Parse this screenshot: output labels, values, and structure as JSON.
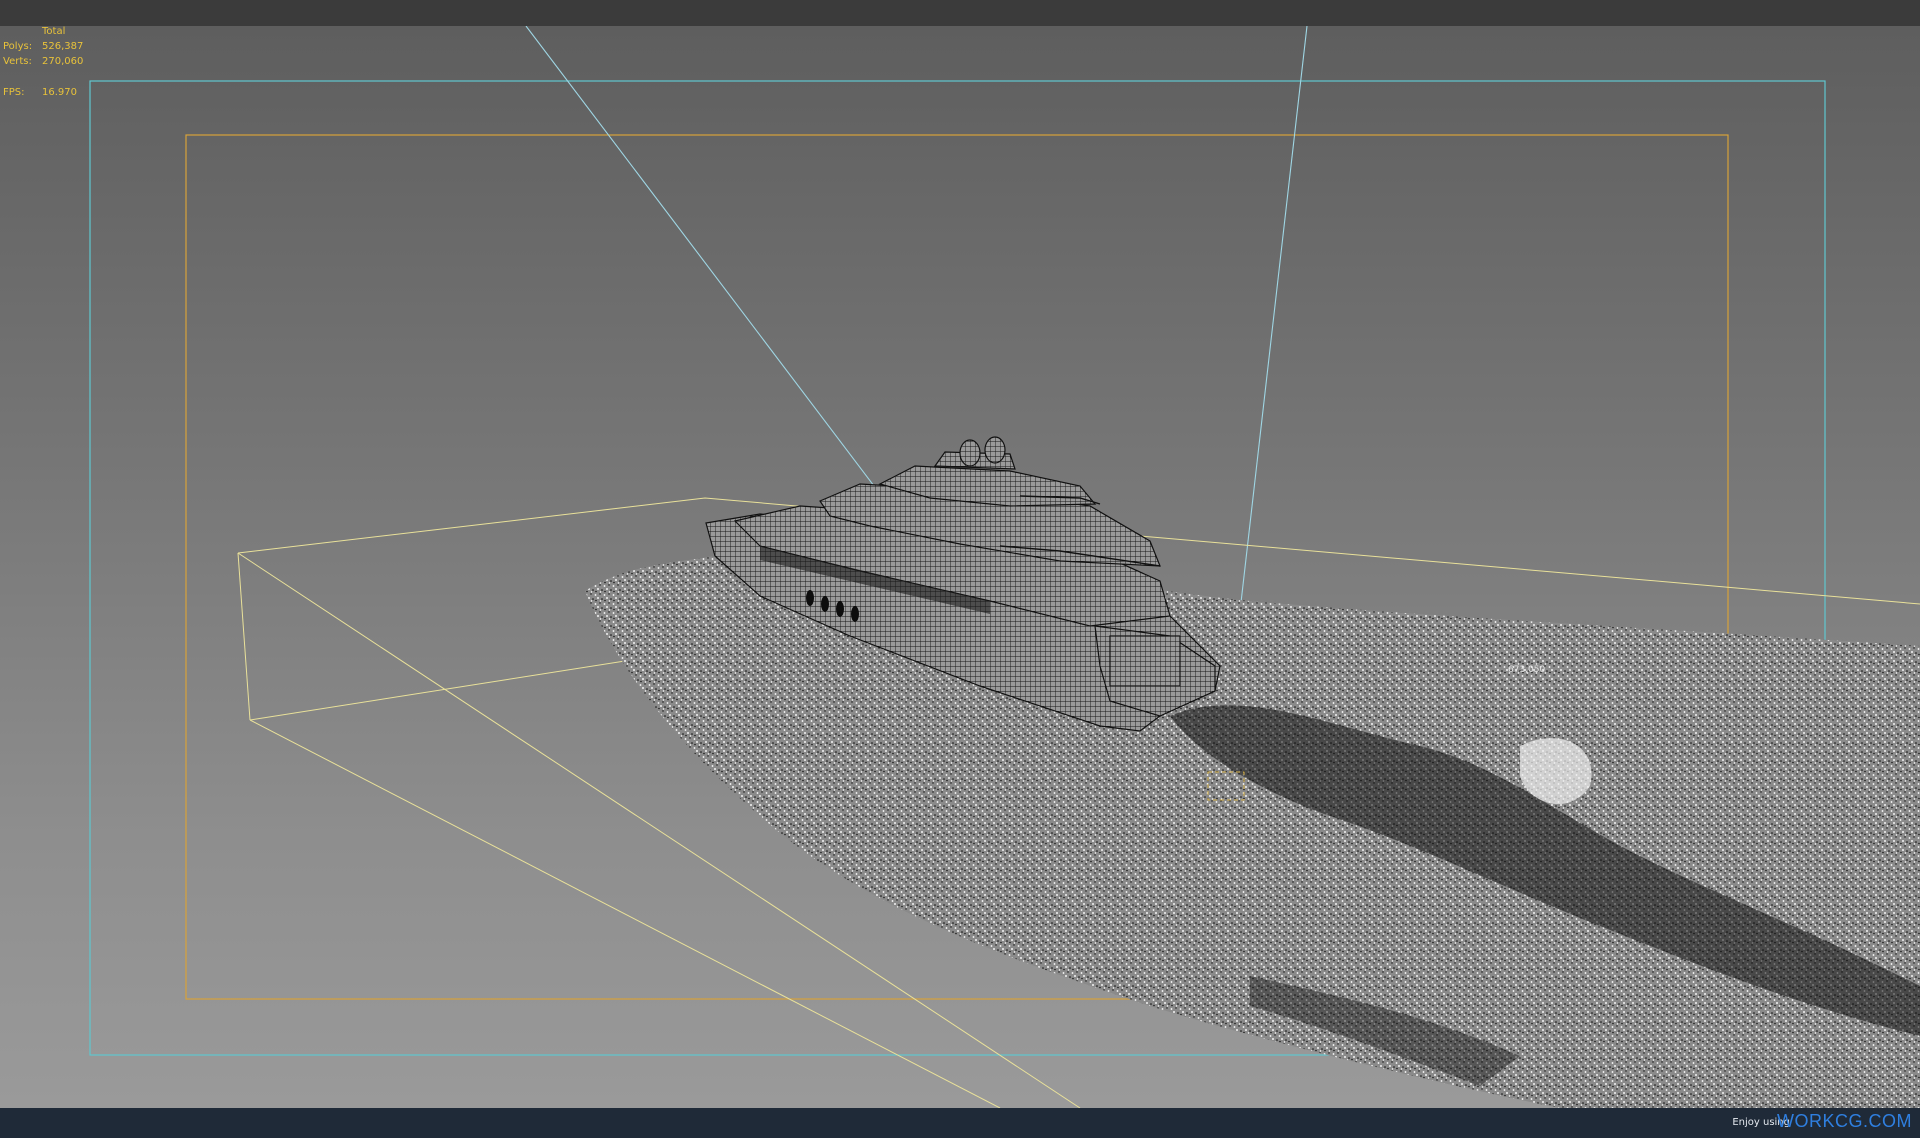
{
  "stats": {
    "header": "Total",
    "polys_label": "Polys:",
    "polys_value": "526,387",
    "verts_label": "Verts:",
    "verts_value": "270,060",
    "fps_label": "FPS:",
    "fps_value": "16.970"
  },
  "scene_label": "673,050",
  "footer": {
    "enjoy_text": "Enjoy using",
    "brand_text": "WORKCG.COM"
  },
  "colors": {
    "safe_frame_outer": "#5fc7cf",
    "safe_frame_inner": "#d7a23a",
    "bounding_box": "#e9e19a",
    "stat_text": "#e8c23a",
    "brand": "#2f7fe0"
  },
  "icons": {
    "scene": "yacht-wireframe-model"
  }
}
